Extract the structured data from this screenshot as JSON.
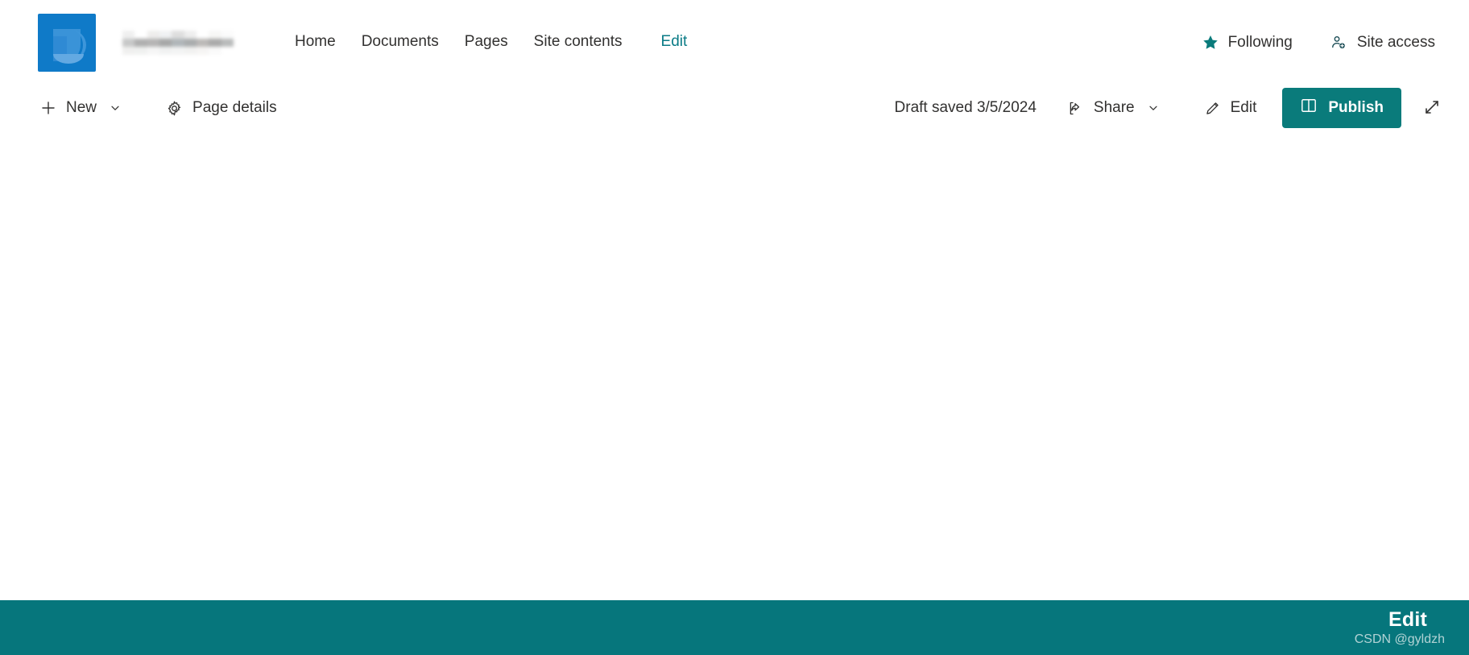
{
  "site_header": {
    "logo_icon": "sharepoint-site-logo",
    "site_title": "",
    "site_title_state": "redacted-blurred",
    "nav": [
      {
        "label": "Home",
        "icon": "",
        "active": false
      },
      {
        "label": "Documents",
        "icon": "",
        "active": false
      },
      {
        "label": "Pages",
        "icon": "",
        "active": false
      },
      {
        "label": "Site contents",
        "icon": "",
        "active": false
      },
      {
        "label": "Edit",
        "icon": "",
        "active": true
      }
    ],
    "actions": [
      {
        "label": "Following",
        "icon": "star-filled-icon"
      },
      {
        "label": "Site access",
        "icon": "people-add-icon"
      }
    ]
  },
  "command_bar": {
    "new_label": "New",
    "new_icon": "plus-icon",
    "new_chevron_icon": "chevron-down-icon",
    "page_details_label": "Page details",
    "page_details_icon": "gear-icon",
    "draft_status": "Draft saved 3/5/2024",
    "share_label": "Share",
    "share_icon": "share-icon",
    "share_chevron_icon": "chevron-down-icon",
    "edit_label": "Edit",
    "edit_icon": "pencil-icon",
    "publish_label": "Publish",
    "publish_icon": "publish-book-icon",
    "expand_icon": "expand-diagonal-icon"
  },
  "footer": {
    "edit_label": "Edit",
    "watermark": "CSDN @gyldzh"
  },
  "colors": {
    "accent_teal": "#0a7b7b",
    "footer_teal": "#06767c",
    "nav_link": "#323130",
    "active_link": "#0a7b86",
    "logo_blue": "#0f7ac8"
  }
}
